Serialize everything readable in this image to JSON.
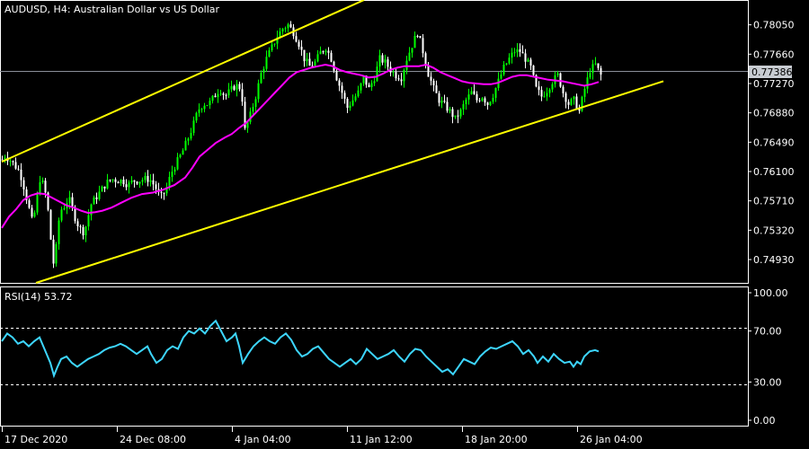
{
  "symbol_header": "AUDUSD, H4:  Australian Dollar vs US Dollar",
  "current_price_label": "0.77386",
  "colors": {
    "background": "#000000",
    "candle_bull": "#00ff00",
    "candle_bear": "#ffffff",
    "moving_average": "#ff00ff",
    "channel_lines": "#ffff00",
    "rsi_line": "#3dd6ff",
    "grid": "#ffffff",
    "current_price_line": "#8a8f99",
    "price_tag_bg": "#c8ccd2"
  },
  "chart_data": [
    {
      "type": "candlestick",
      "title": "AUDUSD, H4:  Australian Dollar vs US Dollar",
      "ylim": [
        0.7462,
        0.7838
      ],
      "y_ticks": [
        "0.78050",
        "0.77660",
        "0.77270",
        "0.76880",
        "0.76490",
        "0.76100",
        "0.75710",
        "0.75320",
        "0.74930"
      ],
      "x_ticks": [
        "17 Dec 2020",
        "24 Dec 08:00",
        "4 Jan 04:00",
        "11 Jan 12:00",
        "18 Jan 20:00",
        "26 Jan 04:00"
      ],
      "price_path": [
        [
          0,
          0.762
        ],
        [
          4,
          0.7632
        ],
        [
          8,
          0.7628
        ],
        [
          12,
          0.7624
        ],
        [
          16,
          0.7618
        ],
        [
          20,
          0.7612
        ],
        [
          24,
          0.76
        ],
        [
          28,
          0.758
        ],
        [
          32,
          0.756
        ],
        [
          36,
          0.754
        ],
        [
          40,
          0.757
        ],
        [
          44,
          0.76
        ],
        [
          48,
          0.7592
        ],
        [
          52,
          0.757
        ],
        [
          56,
          0.752
        ],
        [
          60,
          0.7478
        ],
        [
          64,
          0.754
        ],
        [
          68,
          0.756
        ],
        [
          72,
          0.7565
        ],
        [
          76,
          0.7575
        ],
        [
          80,
          0.756
        ],
        [
          84,
          0.7545
        ],
        [
          88,
          0.7535
        ],
        [
          92,
          0.753
        ],
        [
          96,
          0.754
        ],
        [
          100,
          0.7565
        ],
        [
          106,
          0.7575
        ],
        [
          112,
          0.7585
        ],
        [
          118,
          0.7595
        ],
        [
          124,
          0.76
        ],
        [
          130,
          0.7598
        ],
        [
          136,
          0.7598
        ],
        [
          142,
          0.7592
        ],
        [
          148,
          0.7598
        ],
        [
          154,
          0.7598
        ],
        [
          160,
          0.76
        ],
        [
          166,
          0.76
        ],
        [
          172,
          0.759
        ],
        [
          178,
          0.7575
        ],
        [
          184,
          0.7585
        ],
        [
          190,
          0.7608
        ],
        [
          196,
          0.7622
        ],
        [
          202,
          0.7635
        ],
        [
          208,
          0.7652
        ],
        [
          214,
          0.767
        ],
        [
          220,
          0.7692
        ],
        [
          226,
          0.77
        ],
        [
          232,
          0.77
        ],
        [
          238,
          0.771
        ],
        [
          244,
          0.772
        ],
        [
          250,
          0.771
        ],
        [
          256,
          0.7718
        ],
        [
          262,
          0.7725
        ],
        [
          268,
          0.772
        ],
        [
          272,
          0.7665
        ],
        [
          278,
          0.7685
        ],
        [
          284,
          0.771
        ],
        [
          290,
          0.774
        ],
        [
          296,
          0.776
        ],
        [
          302,
          0.7775
        ],
        [
          308,
          0.779
        ],
        [
          314,
          0.78
        ],
        [
          320,
          0.7805
        ],
        [
          326,
          0.7795
        ],
        [
          332,
          0.778
        ],
        [
          338,
          0.776
        ],
        [
          344,
          0.775
        ],
        [
          350,
          0.7755
        ],
        [
          356,
          0.7768
        ],
        [
          362,
          0.7775
        ],
        [
          368,
          0.776
        ],
        [
          374,
          0.7735
        ],
        [
          380,
          0.7715
        ],
        [
          386,
          0.7695
        ],
        [
          392,
          0.7705
        ],
        [
          398,
          0.7715
        ],
        [
          404,
          0.7735
        ],
        [
          410,
          0.772
        ],
        [
          416,
          0.7735
        ],
        [
          422,
          0.776
        ],
        [
          428,
          0.7755
        ],
        [
          434,
          0.7745
        ],
        [
          440,
          0.7738
        ],
        [
          446,
          0.7735
        ],
        [
          452,
          0.776
        ],
        [
          458,
          0.7778
        ],
        [
          464,
          0.7795
        ],
        [
          470,
          0.777
        ],
        [
          476,
          0.774
        ],
        [
          482,
          0.772
        ],
        [
          488,
          0.7705
        ],
        [
          494,
          0.7698
        ],
        [
          500,
          0.769
        ],
        [
          506,
          0.768
        ],
        [
          512,
          0.769
        ],
        [
          518,
          0.7705
        ],
        [
          524,
          0.7715
        ],
        [
          530,
          0.7705
        ],
        [
          536,
          0.771
        ],
        [
          542,
          0.77
        ],
        [
          548,
          0.7712
        ],
        [
          554,
          0.773
        ],
        [
          560,
          0.7748
        ],
        [
          566,
          0.776
        ],
        [
          572,
          0.777
        ],
        [
          578,
          0.777
        ],
        [
          584,
          0.776
        ],
        [
          590,
          0.7748
        ],
        [
          596,
          0.772
        ],
        [
          602,
          0.771
        ],
        [
          608,
          0.7718
        ],
        [
          614,
          0.773
        ],
        [
          620,
          0.7738
        ],
        [
          626,
          0.7715
        ],
        [
          632,
          0.77
        ],
        [
          638,
          0.7705
        ],
        [
          644,
          0.769
        ],
        [
          650,
          0.772
        ],
        [
          656,
          0.7745
        ],
        [
          662,
          0.7752
        ],
        [
          668,
          0.7738
        ]
      ],
      "moving_average": [
        [
          2,
          0.7535
        ],
        [
          10,
          0.755
        ],
        [
          18,
          0.756
        ],
        [
          26,
          0.7572
        ],
        [
          34,
          0.7578
        ],
        [
          42,
          0.7581
        ],
        [
          50,
          0.758
        ],
        [
          58,
          0.7575
        ],
        [
          66,
          0.757
        ],
        [
          74,
          0.7565
        ],
        [
          82,
          0.7562
        ],
        [
          90,
          0.7558
        ],
        [
          98,
          0.7555
        ],
        [
          106,
          0.7556
        ],
        [
          114,
          0.7558
        ],
        [
          124,
          0.7562
        ],
        [
          134,
          0.7568
        ],
        [
          146,
          0.7575
        ],
        [
          158,
          0.758
        ],
        [
          170,
          0.7582
        ],
        [
          182,
          0.7586
        ],
        [
          194,
          0.7592
        ],
        [
          206,
          0.7602
        ],
        [
          214,
          0.7615
        ],
        [
          222,
          0.763
        ],
        [
          230,
          0.7638
        ],
        [
          240,
          0.7648
        ],
        [
          250,
          0.7655
        ],
        [
          258,
          0.766
        ],
        [
          266,
          0.7668
        ],
        [
          274,
          0.7675
        ],
        [
          282,
          0.7685
        ],
        [
          290,
          0.7695
        ],
        [
          298,
          0.7705
        ],
        [
          306,
          0.7715
        ],
        [
          314,
          0.7725
        ],
        [
          322,
          0.7735
        ],
        [
          330,
          0.7742
        ],
        [
          338,
          0.7745
        ],
        [
          346,
          0.7748
        ],
        [
          354,
          0.775
        ],
        [
          362,
          0.7752
        ],
        [
          370,
          0.775
        ],
        [
          378,
          0.7745
        ],
        [
          386,
          0.7742
        ],
        [
          394,
          0.774
        ],
        [
          402,
          0.7738
        ],
        [
          410,
          0.7735
        ],
        [
          418,
          0.7736
        ],
        [
          426,
          0.774
        ],
        [
          434,
          0.7745
        ],
        [
          442,
          0.7748
        ],
        [
          450,
          0.775
        ],
        [
          458,
          0.775
        ],
        [
          466,
          0.775
        ],
        [
          474,
          0.7752
        ],
        [
          482,
          0.7748
        ],
        [
          490,
          0.7742
        ],
        [
          498,
          0.7738
        ],
        [
          506,
          0.7734
        ],
        [
          514,
          0.773
        ],
        [
          522,
          0.7728
        ],
        [
          530,
          0.7727
        ],
        [
          538,
          0.7726
        ],
        [
          546,
          0.7726
        ],
        [
          554,
          0.7728
        ],
        [
          562,
          0.7732
        ],
        [
          570,
          0.7736
        ],
        [
          578,
          0.7738
        ],
        [
          586,
          0.7738
        ],
        [
          594,
          0.7736
        ],
        [
          602,
          0.7734
        ],
        [
          610,
          0.7732
        ],
        [
          618,
          0.7731
        ],
        [
          626,
          0.773
        ],
        [
          634,
          0.7728
        ],
        [
          642,
          0.7726
        ],
        [
          650,
          0.7724
        ],
        [
          658,
          0.7726
        ],
        [
          666,
          0.7729
        ]
      ],
      "channel_upper": [
        [
          2,
          0.7623
        ],
        [
          405,
          0.7838
        ]
      ],
      "channel_lower": [
        [
          40,
          0.7462
        ],
        [
          738,
          0.773
        ]
      ]
    },
    {
      "type": "line",
      "title": "RSI(14) 53.72",
      "ylim": [
        0,
        100
      ],
      "y_ticks": [
        "100.00",
        "70.00",
        "30.00",
        "0.00"
      ],
      "levels": [
        70,
        30
      ],
      "values": [
        [
          2,
          62
        ],
        [
          8,
          68
        ],
        [
          14,
          65
        ],
        [
          20,
          60
        ],
        [
          26,
          62
        ],
        [
          32,
          58
        ],
        [
          38,
          62
        ],
        [
          44,
          65
        ],
        [
          50,
          55
        ],
        [
          56,
          45
        ],
        [
          60,
          35
        ],
        [
          64,
          42
        ],
        [
          68,
          48
        ],
        [
          74,
          50
        ],
        [
          80,
          45
        ],
        [
          86,
          42
        ],
        [
          92,
          45
        ],
        [
          98,
          48
        ],
        [
          104,
          50
        ],
        [
          110,
          52
        ],
        [
          116,
          55
        ],
        [
          122,
          57
        ],
        [
          128,
          58
        ],
        [
          134,
          60
        ],
        [
          140,
          58
        ],
        [
          146,
          55
        ],
        [
          152,
          52
        ],
        [
          158,
          55
        ],
        [
          164,
          58
        ],
        [
          168,
          52
        ],
        [
          174,
          45
        ],
        [
          180,
          48
        ],
        [
          186,
          55
        ],
        [
          192,
          58
        ],
        [
          198,
          56
        ],
        [
          204,
          65
        ],
        [
          210,
          70
        ],
        [
          216,
          68
        ],
        [
          222,
          72
        ],
        [
          228,
          68
        ],
        [
          234,
          74
        ],
        [
          240,
          78
        ],
        [
          246,
          70
        ],
        [
          252,
          62
        ],
        [
          258,
          65
        ],
        [
          262,
          68
        ],
        [
          266,
          58
        ],
        [
          270,
          45
        ],
        [
          276,
          52
        ],
        [
          282,
          58
        ],
        [
          288,
          62
        ],
        [
          294,
          65
        ],
        [
          300,
          62
        ],
        [
          306,
          60
        ],
        [
          312,
          65
        ],
        [
          318,
          68
        ],
        [
          324,
          63
        ],
        [
          330,
          55
        ],
        [
          336,
          50
        ],
        [
          342,
          52
        ],
        [
          348,
          56
        ],
        [
          354,
          58
        ],
        [
          360,
          53
        ],
        [
          366,
          48
        ],
        [
          372,
          45
        ],
        [
          378,
          42
        ],
        [
          384,
          45
        ],
        [
          390,
          48
        ],
        [
          396,
          44
        ],
        [
          402,
          48
        ],
        [
          408,
          56
        ],
        [
          414,
          52
        ],
        [
          420,
          48
        ],
        [
          426,
          50
        ],
        [
          432,
          52
        ],
        [
          438,
          55
        ],
        [
          444,
          50
        ],
        [
          450,
          46
        ],
        [
          456,
          52
        ],
        [
          462,
          56
        ],
        [
          468,
          55
        ],
        [
          474,
          50
        ],
        [
          480,
          46
        ],
        [
          486,
          42
        ],
        [
          492,
          38
        ],
        [
          498,
          40
        ],
        [
          504,
          36
        ],
        [
          510,
          42
        ],
        [
          516,
          48
        ],
        [
          522,
          46
        ],
        [
          528,
          44
        ],
        [
          534,
          50
        ],
        [
          540,
          54
        ],
        [
          546,
          57
        ],
        [
          552,
          56
        ],
        [
          558,
          58
        ],
        [
          564,
          60
        ],
        [
          570,
          62
        ],
        [
          576,
          58
        ],
        [
          582,
          52
        ],
        [
          588,
          55
        ],
        [
          594,
          50
        ],
        [
          598,
          45
        ],
        [
          604,
          50
        ],
        [
          610,
          46
        ],
        [
          616,
          52
        ],
        [
          622,
          48
        ],
        [
          628,
          45
        ],
        [
          634,
          46
        ],
        [
          638,
          42
        ],
        [
          642,
          46
        ],
        [
          646,
          44
        ],
        [
          650,
          50
        ],
        [
          656,
          54
        ],
        [
          662,
          55
        ],
        [
          666,
          54
        ]
      ]
    }
  ]
}
